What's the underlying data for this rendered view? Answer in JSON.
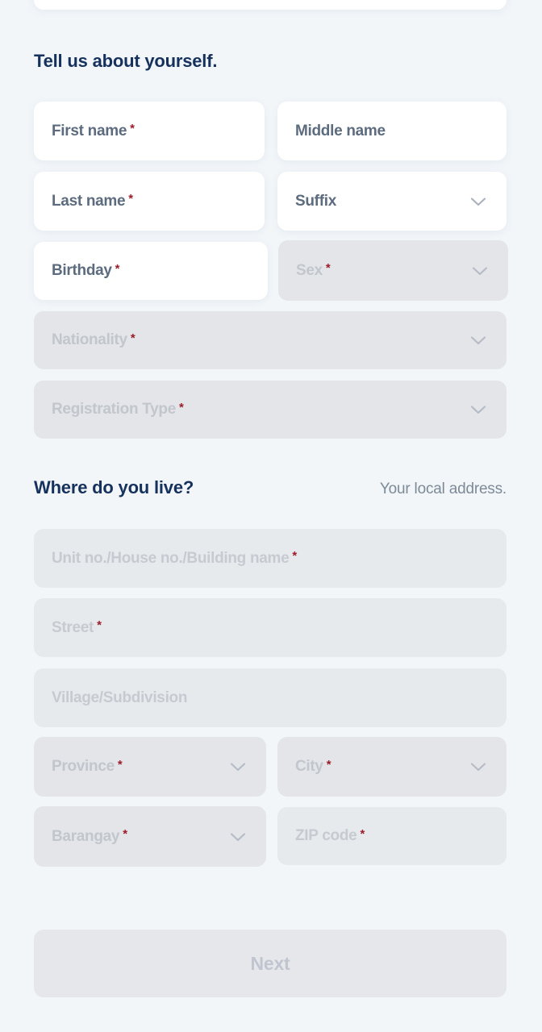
{
  "screen": {
    "background_color": "#f2f6f9",
    "heading_color": "#16325c",
    "required_marker_color": "#9b1c2a",
    "enabled_field_bg": "#ffffff",
    "disabled_field_bg": "#e4e5e9",
    "enabled_label_color": "#5c6b7e",
    "disabled_label_color": "#c2c6cd"
  },
  "sections": {
    "about": {
      "title": "Tell us about yourself.",
      "note": ""
    },
    "address": {
      "title": "Where do you live?",
      "note": "Your local address."
    }
  },
  "required_marker": "*",
  "fields": {
    "first_name": {
      "label": "First name",
      "required": true,
      "type": "text",
      "state": "enabled",
      "placeholder": "First name"
    },
    "middle_name": {
      "label": "Middle name",
      "required": false,
      "type": "text",
      "state": "enabled",
      "placeholder": "Middle name"
    },
    "last_name": {
      "label": "Last name",
      "required": true,
      "type": "text",
      "state": "enabled",
      "placeholder": "Last name"
    },
    "suffix": {
      "label": "Suffix",
      "required": false,
      "type": "select",
      "state": "enabled",
      "placeholder": "Suffix"
    },
    "birthday": {
      "label": "Birthday",
      "required": true,
      "type": "date",
      "state": "enabled",
      "placeholder": "Birthday"
    },
    "sex": {
      "label": "Sex",
      "required": true,
      "type": "select",
      "state": "disabled",
      "placeholder": "Sex"
    },
    "nationality": {
      "label": "Nationality",
      "required": true,
      "type": "select",
      "state": "disabled",
      "placeholder": "Nationality"
    },
    "registration_type": {
      "label": "Registration Type",
      "required": true,
      "type": "select",
      "state": "disabled",
      "placeholder": "Registration Type"
    },
    "unit_no": {
      "label": "Unit no./House no./Building name",
      "required": true,
      "type": "text",
      "state": "disabled",
      "placeholder": "Unit no./House no./Building name"
    },
    "street": {
      "label": "Street",
      "required": true,
      "type": "text",
      "state": "disabled",
      "placeholder": "Street"
    },
    "village": {
      "label": "Village/Subdivision",
      "required": false,
      "type": "text",
      "state": "disabled",
      "placeholder": "Village/Subdivision"
    },
    "province": {
      "label": "Province",
      "required": true,
      "type": "select",
      "state": "disabled",
      "placeholder": "Province"
    },
    "city": {
      "label": "City",
      "required": true,
      "type": "select",
      "state": "disabled",
      "placeholder": "City"
    },
    "barangay": {
      "label": "Barangay",
      "required": true,
      "type": "select",
      "state": "disabled",
      "placeholder": "Barangay"
    },
    "zip_code": {
      "label": "ZIP code",
      "required": true,
      "type": "text",
      "state": "disabled",
      "placeholder": "ZIP code"
    }
  },
  "actions": {
    "next": {
      "label": "Next",
      "state": "disabled"
    }
  },
  "icons": {
    "chevron_down": "chevron-down-icon"
  }
}
